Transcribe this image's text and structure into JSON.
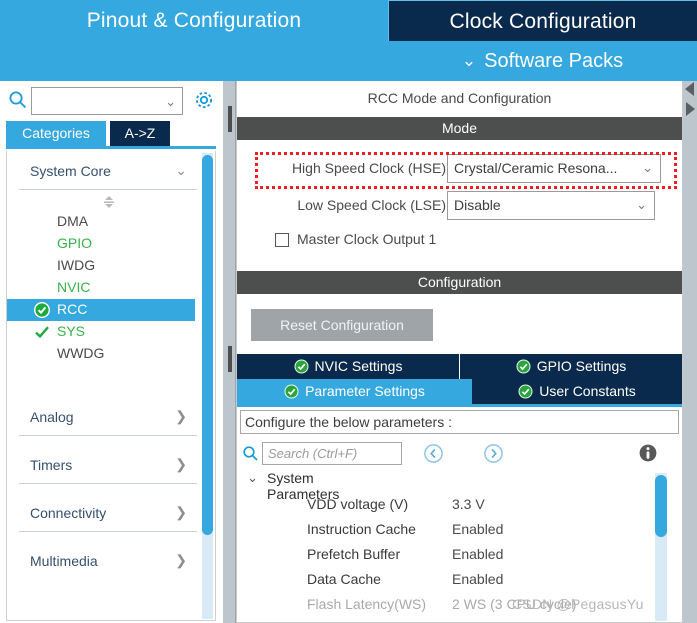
{
  "topbar": {
    "tabs": [
      {
        "label": "Pinout & Configuration",
        "active": false
      },
      {
        "label": "Clock Configuration",
        "active": true
      }
    ],
    "software_packs": "Software Packs",
    "chevron_icon": "chevron-down-icon"
  },
  "sidebar": {
    "search": {
      "value": "",
      "placeholder": ""
    },
    "gear_icon": "gear-icon",
    "search_icon": "search-icon",
    "category_tabs": [
      {
        "label": "Categories",
        "active": true
      },
      {
        "label": "A->Z",
        "active": false
      }
    ],
    "groups": [
      {
        "label": "System Core",
        "expanded": true,
        "arrow": "chevron-down-icon"
      },
      {
        "label": "Analog",
        "expanded": false,
        "arrow": "chevron-right-icon"
      },
      {
        "label": "Timers",
        "expanded": false,
        "arrow": "chevron-right-icon"
      },
      {
        "label": "Connectivity",
        "expanded": false,
        "arrow": "chevron-right-icon"
      },
      {
        "label": "Multimedia",
        "expanded": false,
        "arrow": "chevron-right-icon"
      }
    ],
    "system_core_items": [
      {
        "label": "DMA",
        "state": "none",
        "selected": false
      },
      {
        "label": "GPIO",
        "state": "green",
        "selected": false
      },
      {
        "label": "IWDG",
        "state": "none",
        "selected": false
      },
      {
        "label": "NVIC",
        "state": "green",
        "selected": false
      },
      {
        "label": "RCC",
        "state": "checked",
        "selected": true
      },
      {
        "label": "SYS",
        "state": "check",
        "selected": false
      },
      {
        "label": "WWDG",
        "state": "none",
        "selected": false
      }
    ]
  },
  "panel": {
    "title": "RCC Mode and Configuration",
    "mode_header": "Mode",
    "configuration_header": "Configuration",
    "mode_rows": [
      {
        "label": "High Speed Clock (HSE)",
        "value": "Crystal/Ceramic Resona...",
        "highlighted": true
      },
      {
        "label": "Low Speed Clock (LSE)",
        "value": "Disable",
        "highlighted": false
      }
    ],
    "checkbox": {
      "label": "Master Clock Output 1",
      "checked": false
    },
    "reset_button": "Reset Configuration",
    "config_tabs": [
      {
        "label": "NVIC Settings",
        "active": false,
        "icon": "green-check-icon"
      },
      {
        "label": "GPIO Settings",
        "active": false,
        "icon": "green-check-icon"
      },
      {
        "label": "Parameter Settings",
        "active": true,
        "icon": "green-check-icon"
      },
      {
        "label": "User Constants",
        "active": false,
        "icon": "green-check-icon"
      }
    ],
    "configure_note": "Configure the below parameters :",
    "param_search": {
      "placeholder": "Search (Ctrl+F)",
      "value": "",
      "search_icon": "search-icon",
      "prev_icon": "prev-circle-icon",
      "next_icon": "next-circle-icon",
      "info_icon": "info-icon"
    },
    "param_group": {
      "label": "System Parameters",
      "expanded": true,
      "twisty": "chevron-down-icon"
    },
    "parameters": [
      {
        "name": "VDD voltage (V)",
        "value": "3.3 V",
        "disabled": false
      },
      {
        "name": "Instruction Cache",
        "value": "Enabled",
        "disabled": false
      },
      {
        "name": "Prefetch Buffer",
        "value": "Enabled",
        "disabled": false
      },
      {
        "name": "Data Cache",
        "value": "Enabled",
        "disabled": false
      },
      {
        "name": "Flash Latency(WS)",
        "value": "2 WS (3 CPU cycle)",
        "disabled": true
      }
    ]
  },
  "edge": {
    "left_arrow": "triangle-left-icon",
    "right_arrow": "triangle-right-icon"
  },
  "watermark": "CSDN @PegasusYu",
  "colors": {
    "accent_blue": "#35a8df",
    "dark_navy": "#0a2a4d",
    "section_gray": "#4d4f4e",
    "highlight_red": "#f01e1e",
    "green_check": "#37b34a",
    "button_gray": "#9fa4a8"
  }
}
